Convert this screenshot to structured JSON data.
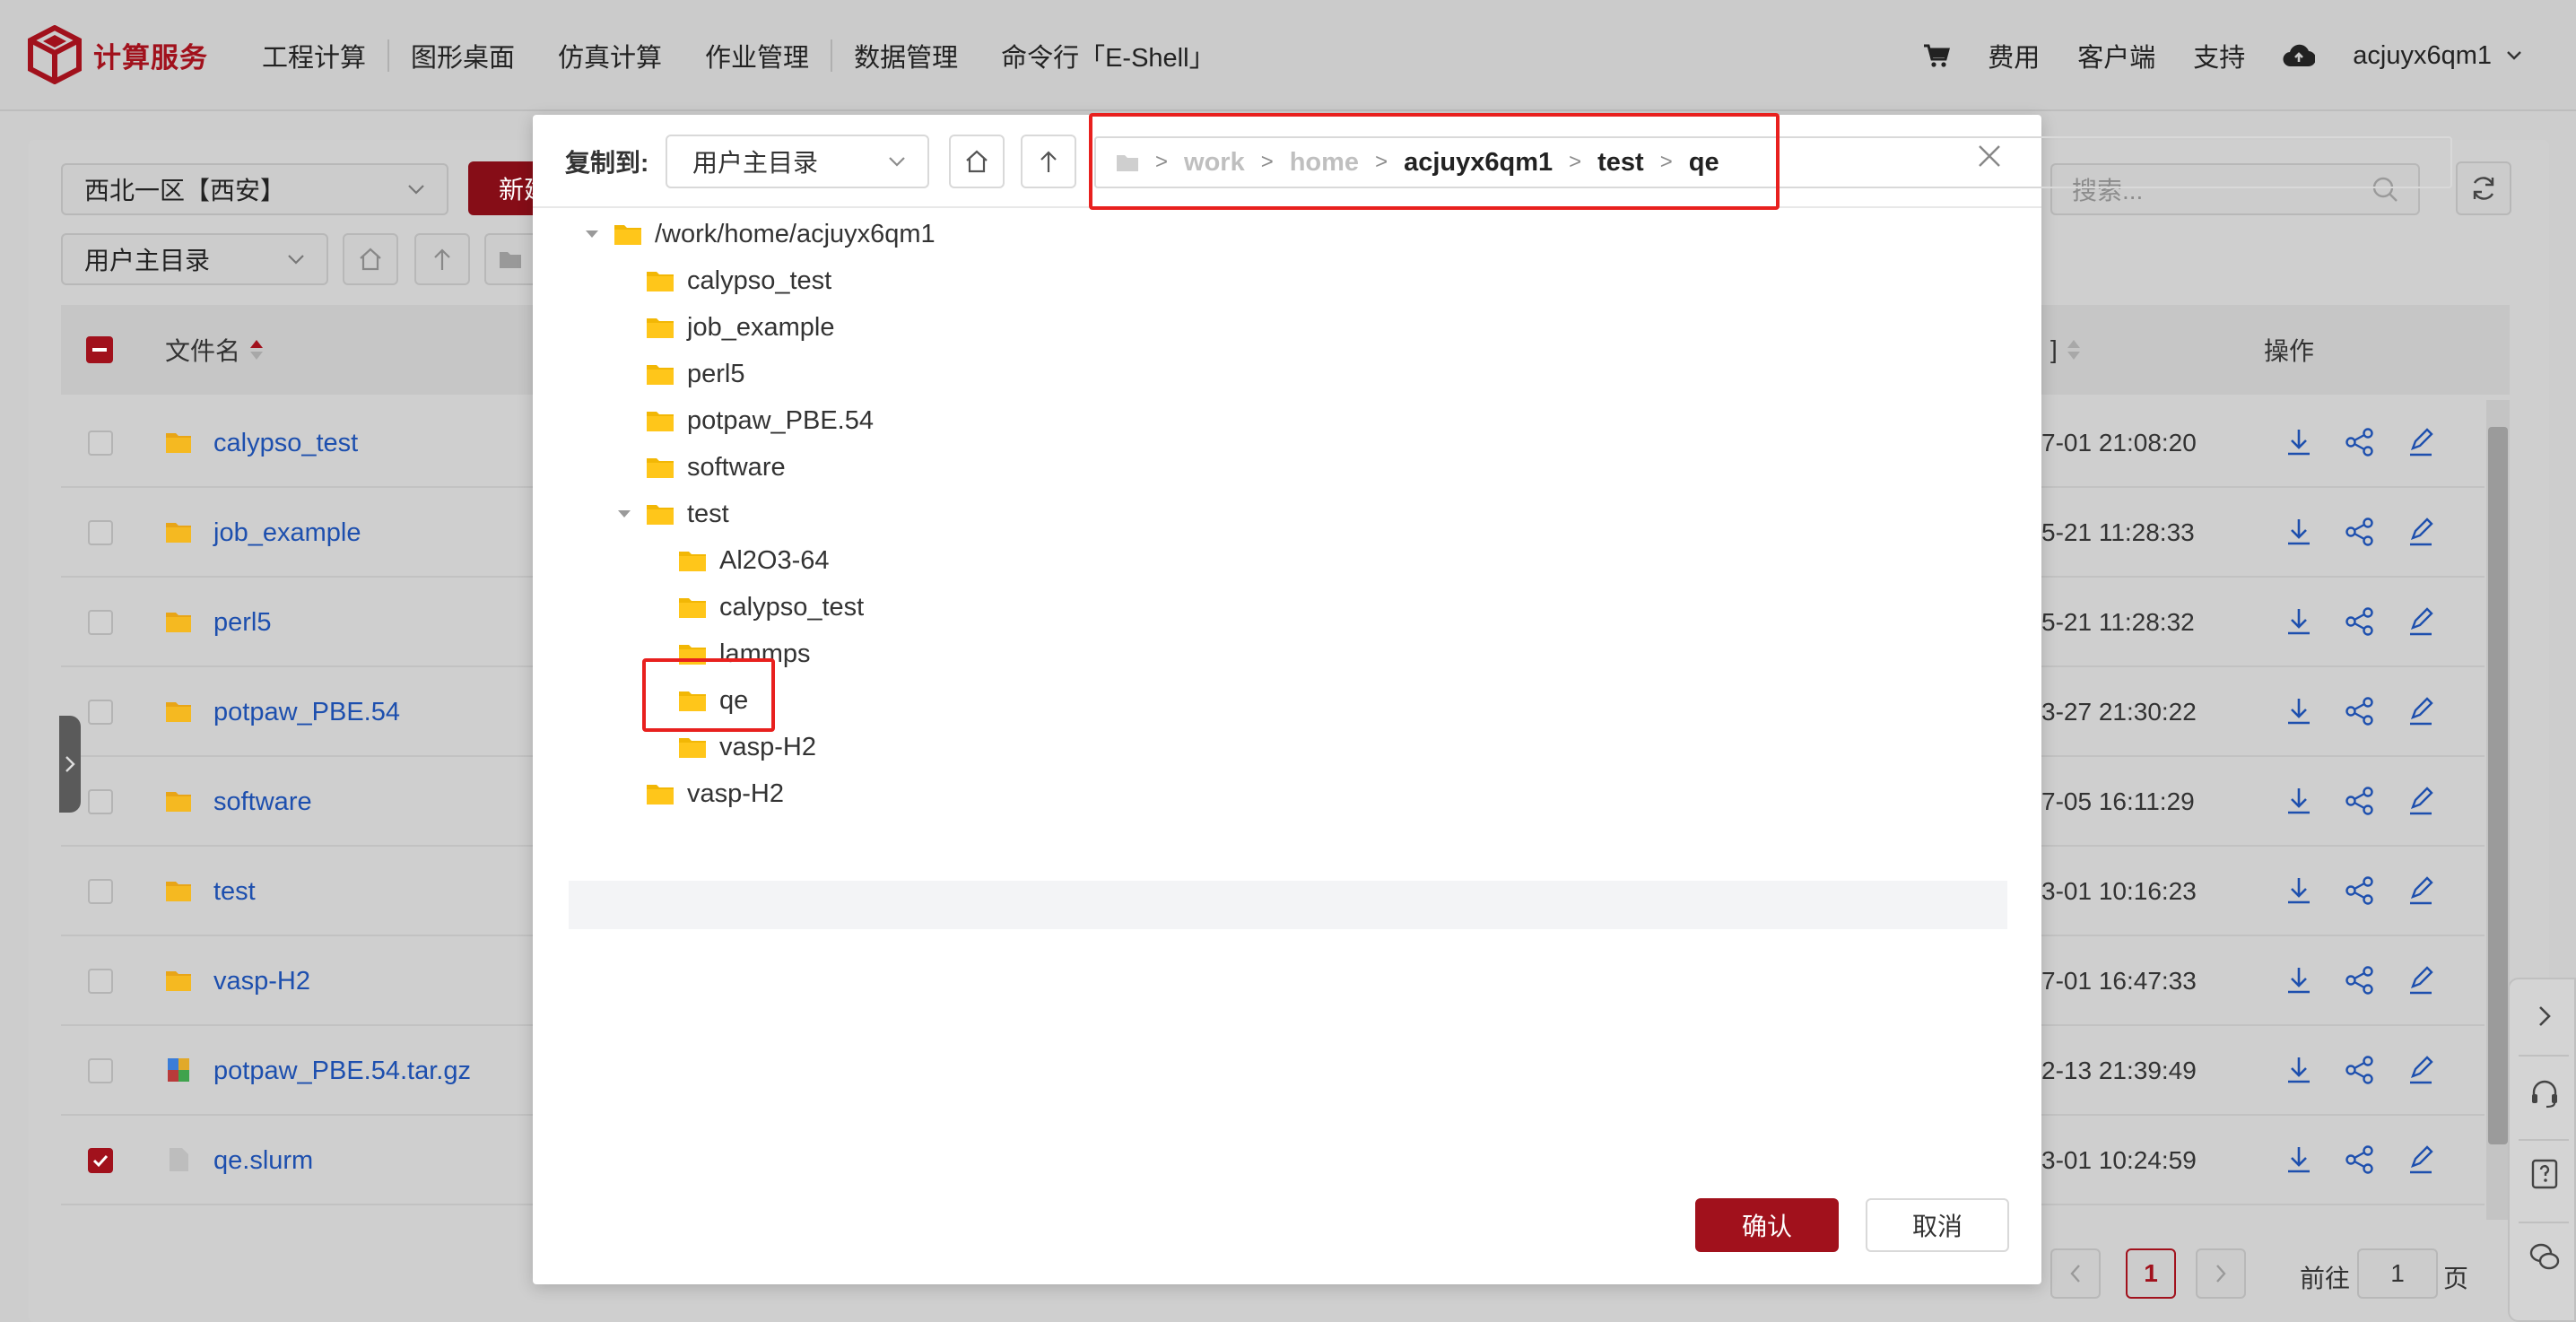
{
  "app": {
    "brand": "计算服务",
    "nav_left": [
      "工程计算",
      "图形桌面",
      "仿真计算",
      "作业管理",
      "数据管理",
      "命令行「E-Shell」"
    ],
    "nav_right": {
      "fee": "费用",
      "client": "客户端",
      "support": "支持",
      "user": "acjuyx6qm1"
    }
  },
  "background": {
    "region": "西北一区【西安】",
    "new_button": "新建",
    "dir_select": "用户主目录",
    "search_placeholder": "搜索...",
    "columns": {
      "name": "文件名",
      "actions": "操作"
    },
    "files": [
      {
        "name": "calypso_test",
        "type": "folder",
        "date": "7-01 21:08:20",
        "checked": false
      },
      {
        "name": "job_example",
        "type": "folder",
        "date": "5-21 11:28:33",
        "checked": false
      },
      {
        "name": "perl5",
        "type": "folder",
        "date": "5-21 11:28:32",
        "checked": false
      },
      {
        "name": "potpaw_PBE.54",
        "type": "folder",
        "date": "3-27 21:30:22",
        "checked": false
      },
      {
        "name": "software",
        "type": "folder",
        "date": "7-05 16:11:29",
        "checked": false
      },
      {
        "name": "test",
        "type": "folder",
        "date": "3-01 10:16:23",
        "checked": false
      },
      {
        "name": "vasp-H2",
        "type": "folder",
        "date": "7-01 16:47:33",
        "checked": false
      },
      {
        "name": "potpaw_PBE.54.tar.gz",
        "type": "archive",
        "date": "2-13 21:39:49",
        "checked": false
      },
      {
        "name": "qe.slurm",
        "type": "file",
        "date": "3-01 10:24:59",
        "checked": true
      }
    ],
    "pager": {
      "current": "1",
      "goto_label": "前往",
      "goto_value": "1",
      "page_unit": "页"
    }
  },
  "modal": {
    "label": "复制到:",
    "dir_select": "用户主目录",
    "breadcrumb": [
      "work",
      "home",
      "acjuyx6qm1",
      "test",
      "qe"
    ],
    "tree": {
      "root": "/work/home/acjuyx6qm1",
      "children": [
        "calypso_test",
        "job_example",
        "perl5",
        "potpaw_PBE.54",
        "software",
        "test",
        "vasp-H2"
      ],
      "test_children": [
        "Al2O3-64",
        "calypso_test",
        "lammps",
        "qe",
        "vasp-H2"
      ],
      "selected": "qe"
    },
    "confirm": "确认",
    "cancel": "取消"
  },
  "colors": {
    "brand_red": "#a1111c",
    "link_blue": "#1d4fae",
    "folder_yellow": "#ffc107",
    "highlight_red": "#e8201e"
  }
}
